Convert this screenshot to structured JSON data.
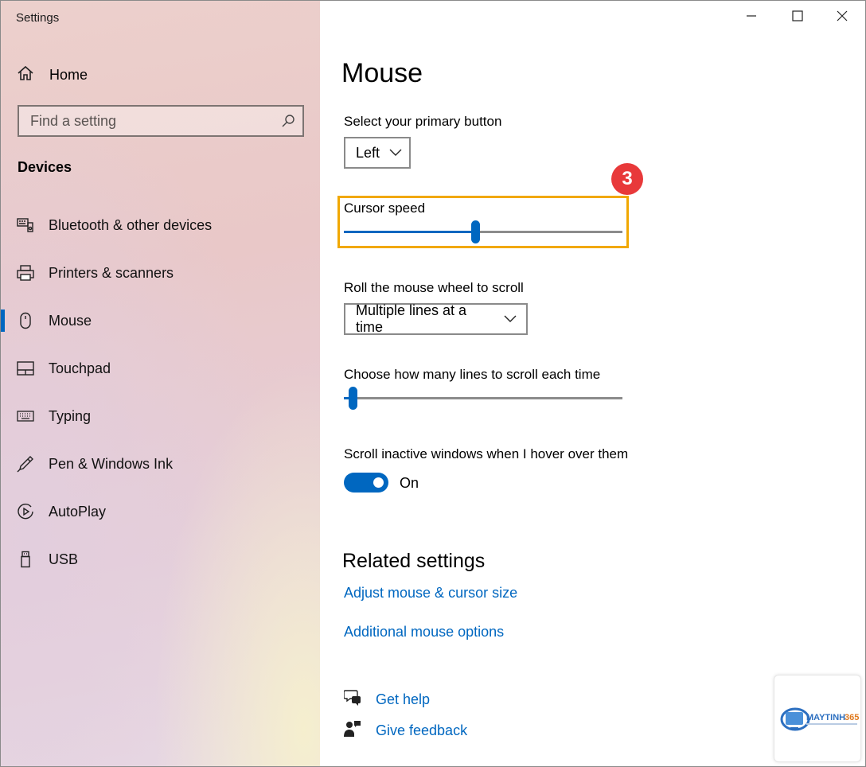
{
  "window": {
    "title": "Settings"
  },
  "sidebar": {
    "home_label": "Home",
    "search_placeholder": "Find a setting",
    "section_title": "Devices",
    "items": [
      {
        "label": "Bluetooth & other devices",
        "icon": "bluetooth-devices-icon"
      },
      {
        "label": "Printers & scanners",
        "icon": "printer-icon"
      },
      {
        "label": "Mouse",
        "icon": "mouse-icon",
        "active": true
      },
      {
        "label": "Touchpad",
        "icon": "touchpad-icon"
      },
      {
        "label": "Typing",
        "icon": "keyboard-icon"
      },
      {
        "label": "Pen & Windows Ink",
        "icon": "pen-icon"
      },
      {
        "label": "AutoPlay",
        "icon": "autoplay-icon"
      },
      {
        "label": "USB",
        "icon": "usb-icon"
      }
    ]
  },
  "main": {
    "title": "Mouse",
    "primary_button": {
      "label": "Select your primary button",
      "value": "Left"
    },
    "cursor_speed": {
      "label": "Cursor speed",
      "value_fraction": 0.47
    },
    "annotation_badge": "3",
    "scroll_mode": {
      "label": "Roll the mouse wheel to scroll",
      "value": "Multiple lines at a time"
    },
    "lines_to_scroll": {
      "label": "Choose how many lines to scroll each time",
      "value_fraction": 0.03
    },
    "inactive_scroll": {
      "label": "Scroll inactive windows when I hover over them",
      "state_label": "On",
      "on": true
    },
    "related": {
      "title": "Related settings",
      "links": [
        "Adjust mouse & cursor size",
        "Additional mouse options"
      ]
    },
    "help": {
      "get_help": "Get help",
      "give_feedback": "Give feedback"
    }
  },
  "colors": {
    "accent": "#0067c0",
    "highlight": "#f1a800",
    "badge": "#e8393a"
  }
}
